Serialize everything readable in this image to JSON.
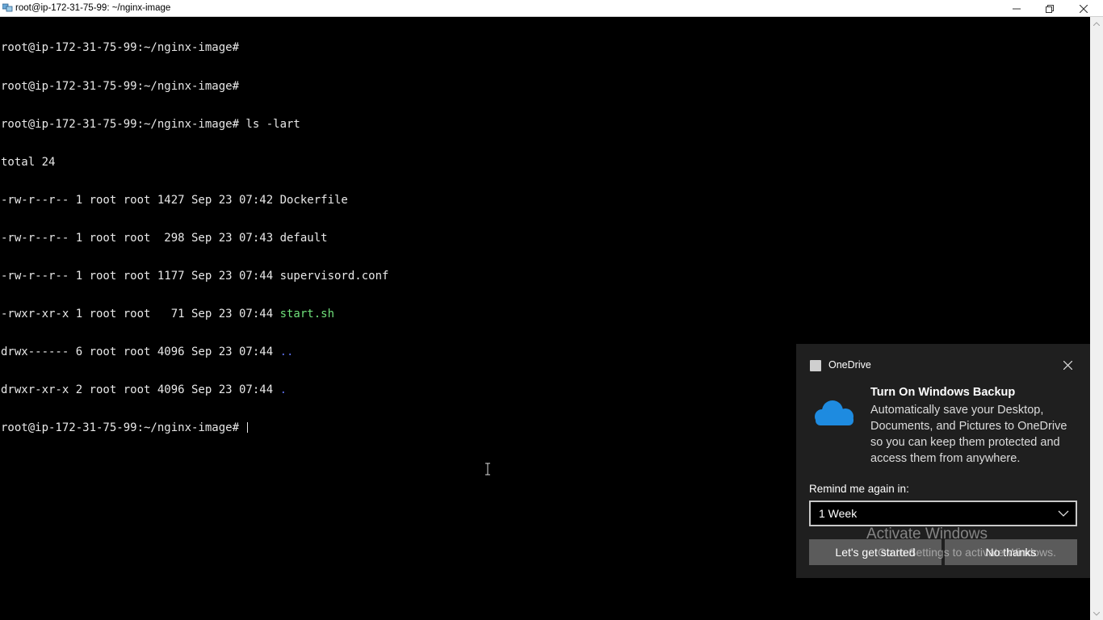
{
  "window": {
    "title": "root@ip-172-31-75-99: ~/nginx-image"
  },
  "terminal": {
    "lines": [
      "root@ip-172-31-75-99:~/nginx-image#",
      "root@ip-172-31-75-99:~/nginx-image#",
      "root@ip-172-31-75-99:~/nginx-image# ls -lart",
      "total 24"
    ],
    "listing": [
      {
        "meta": "-rw-r--r-- 1 root root 1427 Sep 23 07:42 ",
        "name": "Dockerfile",
        "kind": "file"
      },
      {
        "meta": "-rw-r--r-- 1 root root  298 Sep 23 07:43 ",
        "name": "default",
        "kind": "file"
      },
      {
        "meta": "-rw-r--r-- 1 root root 1177 Sep 23 07:44 ",
        "name": "supervisord.conf",
        "kind": "file"
      },
      {
        "meta": "-rwxr-xr-x 1 root root   71 Sep 23 07:44 ",
        "name": "start.sh",
        "kind": "exec"
      },
      {
        "meta": "drwx------ 6 root root 4096 Sep 23 07:44 ",
        "name": "..",
        "kind": "dir"
      },
      {
        "meta": "drwxr-xr-x 2 root root 4096 Sep 23 07:44 ",
        "name": ".",
        "kind": "dir"
      }
    ],
    "prompt": "root@ip-172-31-75-99:~/nginx-image# ",
    "colors": {
      "text": "#e8e8e8",
      "exec": "#6fe07a",
      "dir": "#5b6ee8",
      "background": "#000000"
    }
  },
  "toast": {
    "app_name": "OneDrive",
    "icons": {
      "app": "onedrive-app-icon",
      "hero": "onedrive-cloud-icon",
      "close": "close-icon"
    },
    "heading": "Turn On Windows Backup",
    "body": "Automatically save your Desktop, Documents, and Pictures to OneDrive so you can keep them protected and access them from anywhere.",
    "remind_label": "Remind me again in:",
    "remind_value": "1 Week",
    "primary_button": "Let's get started",
    "secondary_button": "No thanks",
    "colors": {
      "background": "#1f1f1f",
      "button": "#5b5b5b",
      "cloud": "#1e8be0"
    }
  },
  "watermark": {
    "line1": "Activate Windows",
    "line2": "Go to Settings to activate Windows."
  }
}
